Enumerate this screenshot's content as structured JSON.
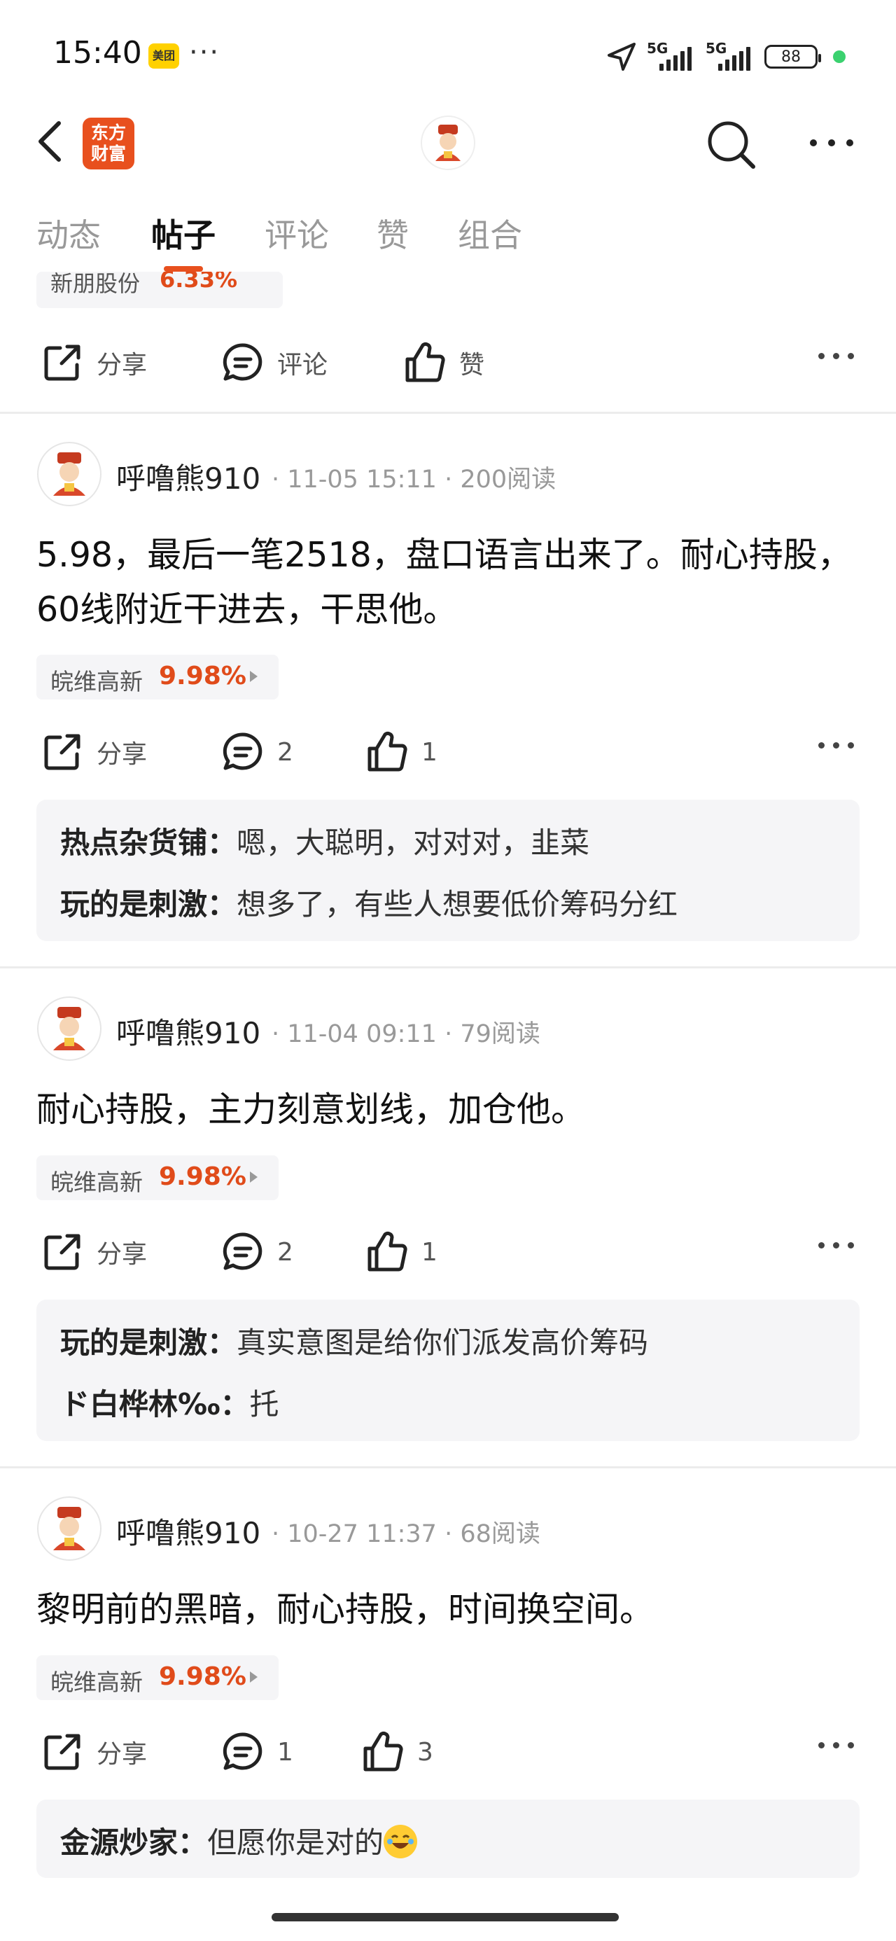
{
  "status_bar": {
    "time": "15:40",
    "app_badge": "美团",
    "dots": "···",
    "net1": "5G",
    "net2": "5G",
    "battery": "88"
  },
  "header": {
    "logo_line1": "东方",
    "logo_line2": "财富"
  },
  "tabs": [
    "动态",
    "帖子",
    "评论",
    "赞",
    "组合"
  ],
  "peek_post": {
    "stock_name": "新朋股份",
    "stock_pct": "6.33%",
    "share": "分享",
    "comment": "评论",
    "like": "赞"
  },
  "posts": [
    {
      "author": "呼噜熊910",
      "meta": "· 11-05 15:11 · 200阅读",
      "text": "5.98，最后一笔2518，盘口语言出来了。耐心持股，60线附近干进去，干思他。",
      "stock_name": "皖维高新",
      "stock_pct": "9.98%",
      "share": "分享",
      "comment_count": "2",
      "like_count": "1",
      "comments": [
        {
          "user": "热点杂货铺：",
          "text": "嗯，大聪明，对对对，韭菜"
        },
        {
          "user": "玩的是刺激：",
          "text": "想多了，有些人想要低价筹码分红"
        }
      ]
    },
    {
      "author": "呼噜熊910",
      "meta": "· 11-04 09:11 · 79阅读",
      "text": "耐心持股，主力刻意划线，加仓他。",
      "stock_name": "皖维高新",
      "stock_pct": "9.98%",
      "share": "分享",
      "comment_count": "2",
      "like_count": "1",
      "comments": [
        {
          "user": "玩的是刺激：",
          "text": "真实意图是给你们派发高价筹码"
        },
        {
          "user": "ド白桦林‰：",
          "text": "托"
        }
      ]
    },
    {
      "author": "呼噜熊910",
      "meta": "· 10-27 11:37 · 68阅读",
      "text": "黎明前的黑暗，耐心持股，时间换空间。",
      "stock_name": "皖维高新",
      "stock_pct": "9.98%",
      "share": "分享",
      "comment_count": "1",
      "like_count": "3",
      "comments": [
        {
          "user": "金源炒家：",
          "text": "但愿你是对的"
        }
      ]
    }
  ]
}
